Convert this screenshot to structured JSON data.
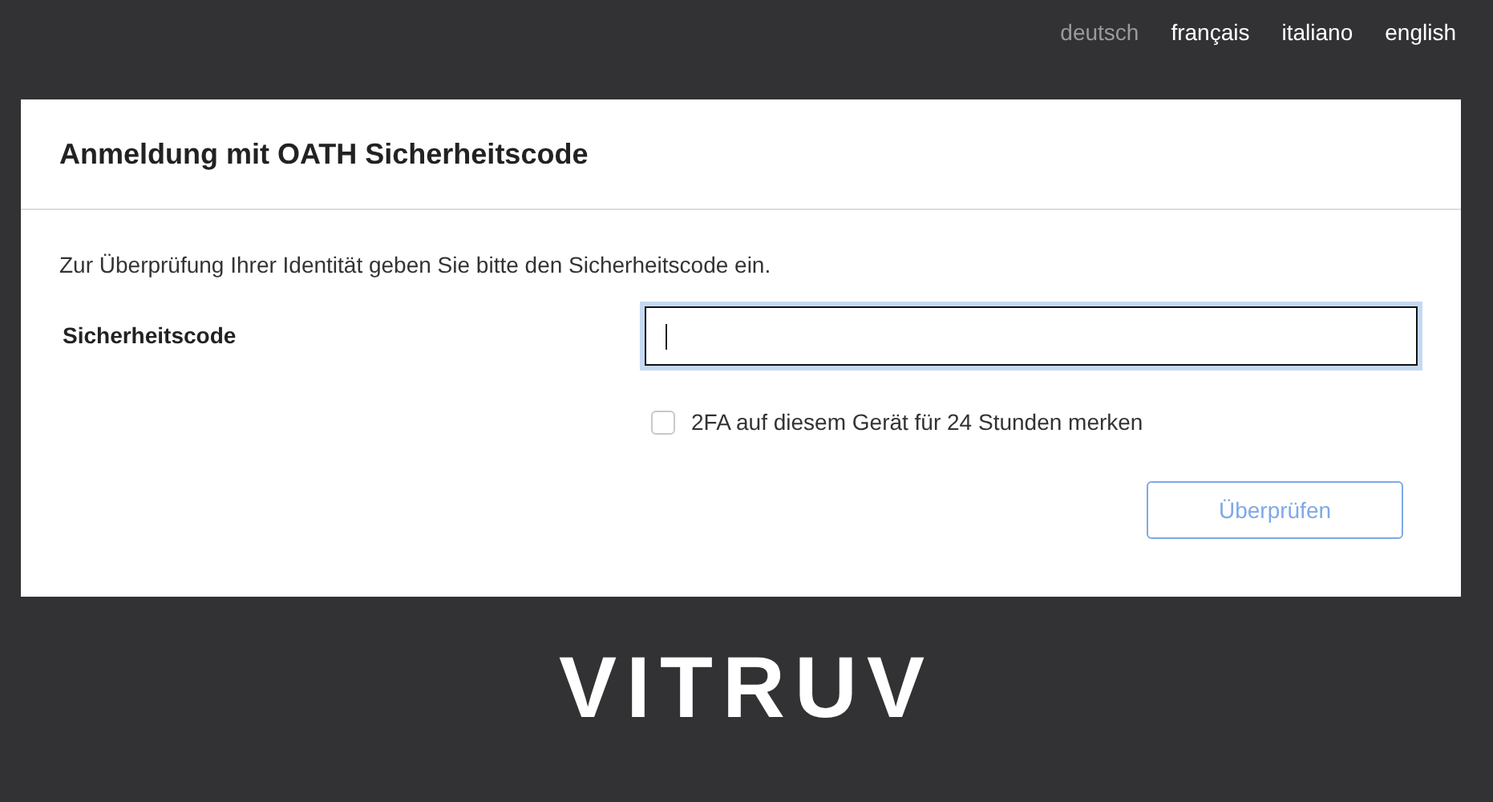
{
  "languages": [
    {
      "label": "deutsch",
      "selected": true
    },
    {
      "label": "français",
      "selected": false
    },
    {
      "label": "italiano",
      "selected": false
    },
    {
      "label": "english",
      "selected": false
    }
  ],
  "card": {
    "title": "Anmeldung mit OATH Sicherheitscode",
    "instruction": "Zur Überprüfung Ihrer Identität geben Sie bitte den Sicherheitscode ein.",
    "field": {
      "label": "Sicherheitscode",
      "focused": true
    },
    "remember": {
      "label": "2FA auf diesem Gerät für 24 Stunden merken",
      "checked": false
    },
    "submit": {
      "label": "Überprüfen"
    }
  },
  "logo": "VITRUV"
}
